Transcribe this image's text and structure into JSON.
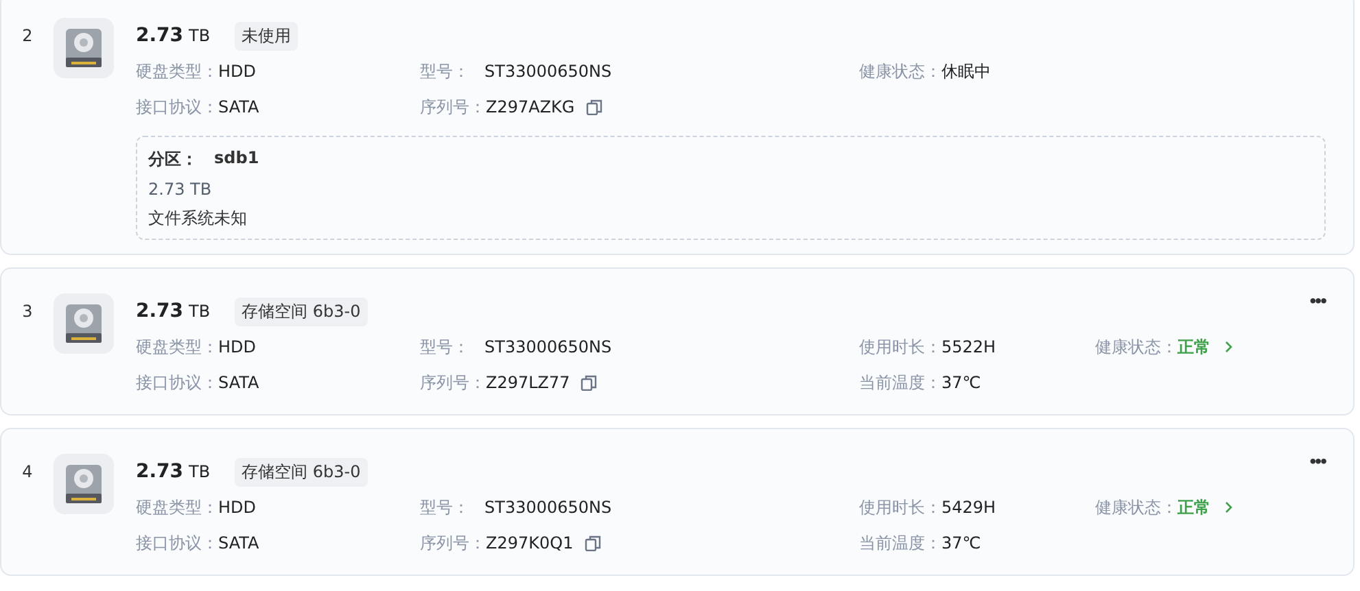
{
  "disks": [
    {
      "index": "2",
      "size": "2.73",
      "unit": "TB",
      "tag": "未使用",
      "rows": [
        [
          {
            "label": "硬盘类型：",
            "value": "HDD",
            "kind": "type"
          },
          {
            "label": "型号：",
            "value": "ST33000650NS",
            "kind": "model"
          },
          {
            "label": "健康状态：",
            "value": "休眠中",
            "kind": "state"
          }
        ],
        [
          {
            "label": "接口协议：",
            "value": "SATA",
            "kind": "interface"
          },
          {
            "label": "序列号：",
            "value": "Z297AZKG",
            "kind": "serial"
          }
        ]
      ],
      "partitions": [
        {
          "label": "分区：",
          "name": "sdb1",
          "size": "2.73 TB",
          "fs": "文件系统未知"
        }
      ]
    },
    {
      "index": "3",
      "size": "2.73",
      "unit": "TB",
      "tag": "存储空间 6b3-0",
      "menu": "•••",
      "rows": [
        [
          {
            "label": "硬盘类型：",
            "value": "HDD",
            "kind": "type"
          },
          {
            "label": "型号：",
            "value": "ST33000650NS",
            "kind": "model"
          },
          {
            "label": "使用时长：",
            "value": "5522H",
            "kind": "hours"
          },
          {
            "label": "健康状态：",
            "value": "正常",
            "kind": "health"
          }
        ],
        [
          {
            "label": "接口协议：",
            "value": "SATA",
            "kind": "interface"
          },
          {
            "label": "序列号：",
            "value": "Z297LZ77",
            "kind": "serial"
          },
          {
            "label": "当前温度：",
            "value": "37℃",
            "kind": "temp"
          }
        ]
      ]
    },
    {
      "index": "4",
      "size": "2.73",
      "unit": "TB",
      "tag": "存储空间 6b3-0",
      "menu": "•••",
      "rows": [
        [
          {
            "label": "硬盘类型：",
            "value": "HDD",
            "kind": "type"
          },
          {
            "label": "型号：",
            "value": "ST33000650NS",
            "kind": "model"
          },
          {
            "label": "使用时长：",
            "value": "5429H",
            "kind": "hours"
          },
          {
            "label": "健康状态：",
            "value": "正常",
            "kind": "health"
          }
        ],
        [
          {
            "label": "接口协议：",
            "value": "SATA",
            "kind": "interface"
          },
          {
            "label": "序列号：",
            "value": "Z297K0Q1",
            "kind": "serial"
          },
          {
            "label": "当前温度：",
            "value": "37℃",
            "kind": "temp"
          }
        ]
      ]
    }
  ]
}
